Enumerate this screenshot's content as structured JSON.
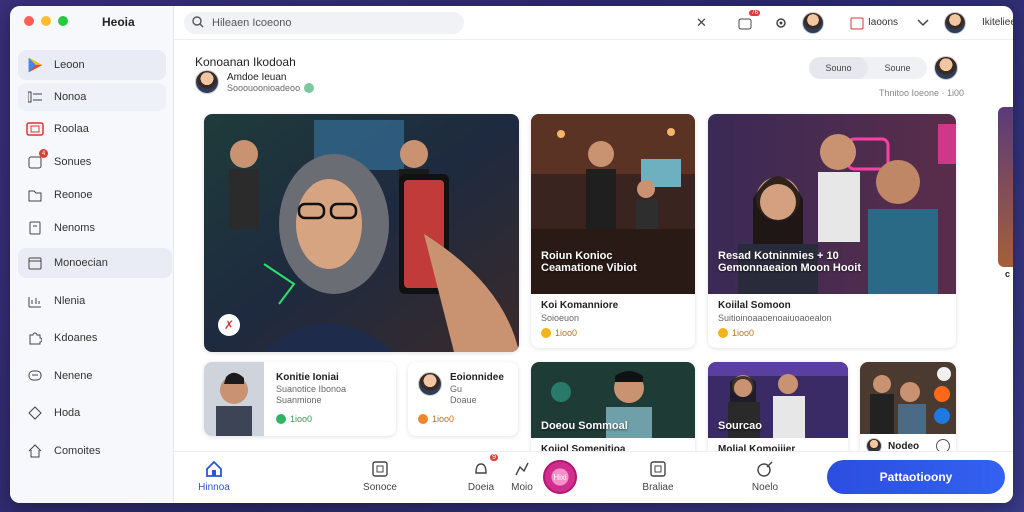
{
  "app": {
    "title": "Heoia"
  },
  "sidebar": {
    "items": [
      {
        "label": "Leoon",
        "icon": "play-logo-icon"
      },
      {
        "label": "Nonoa",
        "icon": "list-icon"
      },
      {
        "label": "Roolaa",
        "icon": "tv-icon"
      },
      {
        "label": "Sonues",
        "icon": "bell-icon",
        "badge": "4"
      },
      {
        "label": "Reonoe",
        "icon": "folder-icon"
      },
      {
        "label": "Nenoms",
        "icon": "doc-icon"
      },
      {
        "label": "Monoecian",
        "icon": "calendar-icon"
      },
      {
        "label": "Nlenia",
        "icon": "chart-icon"
      },
      {
        "label": "Kdoanes",
        "icon": "puzzle-icon"
      },
      {
        "label": "Nenene",
        "icon": "chat-icon"
      },
      {
        "label": "Hoda",
        "icon": "tag-icon"
      },
      {
        "label": "Comoites",
        "icon": "home-icon"
      }
    ]
  },
  "topbar": {
    "search_value": "Hileaen Icoeono",
    "notif_badge": "76",
    "user_name": "Iaoons",
    "user2_name": "Ikiteliee"
  },
  "section": {
    "title": "Konoanan Ikodoah",
    "author_name": "Amdoe Ieuan",
    "author_sub": "Sooouoonioadeoo",
    "filters": [
      "Souno",
      "Soune"
    ],
    "time": "Thnitoo Ioeone · 1i00"
  },
  "cards": [
    {
      "overlay": "",
      "title": "",
      "sub": "",
      "value": ""
    },
    {
      "overlay": "Roiun Konioc\nCeamatione Vibiot",
      "title": "Koi Komanniore",
      "sub": "Soioeuon",
      "value": "1ioo0"
    },
    {
      "overlay": "Resad Kotninmies + 10\nGemonnaeaion Moon Hooit",
      "title": "Koiilal Somoon",
      "sub": "Suitioinoaaoenoaiuoaoealon",
      "value": "1ioo0"
    }
  ],
  "row2": [
    {
      "title": "Konitie Ioniai",
      "sub1": "Suanotice Ibonoa",
      "sub2": "Suanmione",
      "value": "1ioo0"
    },
    {
      "title": "Eoionnidee",
      "sub1": "Gu",
      "sub2": "Doaue",
      "value": "1ioo0"
    },
    {
      "overlay": "Doeou Sommoal",
      "title": "Koiiol Somenitioa"
    },
    {
      "overlay": "Sourcao",
      "title": "Molial Komoiiier"
    },
    {
      "title": "Nodeo"
    }
  ],
  "edge_text": "c",
  "bottombar": {
    "items": [
      {
        "label": "Hinnoa",
        "icon": "home-icon"
      },
      {
        "label": "Sonoce",
        "icon": "square-icon"
      },
      {
        "label": "Doeia",
        "icon": "bell-icon",
        "badge": "9"
      },
      {
        "label": "Moio",
        "icon": "chart-icon"
      },
      {
        "label": "Braliae",
        "icon": "frame-icon"
      },
      {
        "label": "Noelo",
        "icon": "edit-icon"
      }
    ],
    "round_badge": "Hixi",
    "cta": "Pattaotioony"
  },
  "colors": {
    "accent": "#2c4ee0",
    "badge": "#e53935"
  }
}
